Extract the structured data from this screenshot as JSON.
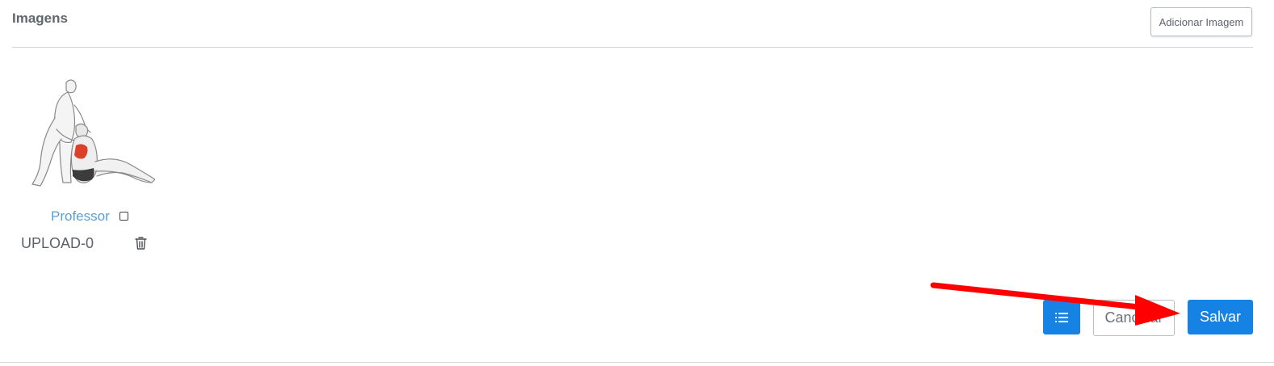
{
  "section": {
    "title": "Imagens"
  },
  "toolbar": {
    "add_image_label": "Adicionar Imagem"
  },
  "gallery": {
    "items": [
      {
        "owner_label": "Professor",
        "owner_checked": false,
        "file_name": "UPLOAD-0",
        "image": "exercise-illustration"
      }
    ]
  },
  "actions": {
    "list_icon": "list-icon",
    "cancel_label": "Cancelar",
    "save_label": "Salvar"
  },
  "colors": {
    "primary": "#1683e4",
    "link": "#5a9fd4",
    "annotation_arrow": "#ff0000"
  }
}
